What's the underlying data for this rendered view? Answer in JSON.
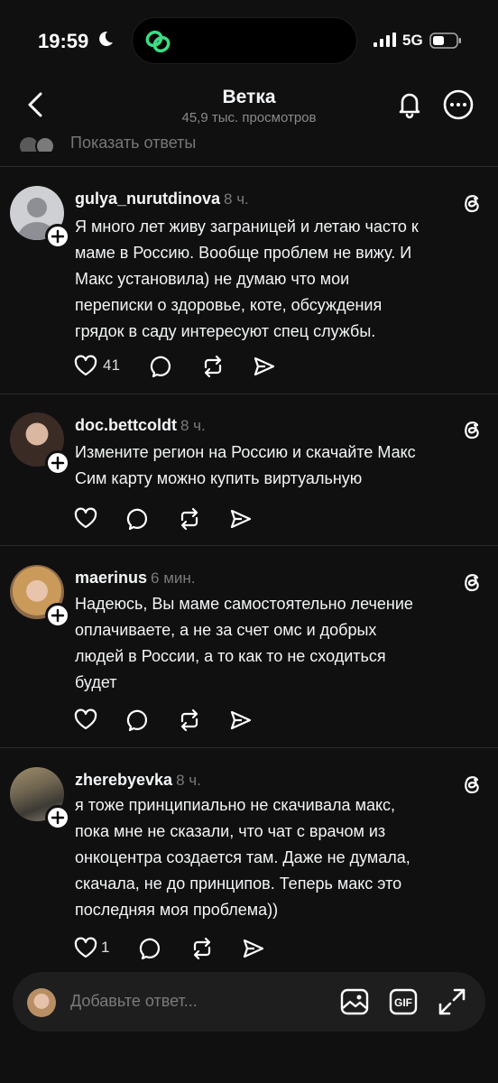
{
  "status_bar": {
    "time": "19:59",
    "network": "5G"
  },
  "header": {
    "title": "Ветка",
    "subtitle": "45,9 тыс. просмотров"
  },
  "show_replies": {
    "label": "Показать ответы"
  },
  "posts": [
    {
      "username": "gulya_nurutdinova",
      "time": "8 ч.",
      "lines": [
        "Я много лет живу заграницей и летаю часто к",
        "маме в Россию. Вообще проблем не вижу. И",
        "Макс установила) не думаю что мои",
        "переписки о здоровье, коте, обсуждения",
        "грядок в саду интересуют спец службы."
      ],
      "likes": "41"
    },
    {
      "username": "doc.bettcoldt",
      "time": "8 ч.",
      "lines": [
        "Измените регион на Россию и скачайте Макс",
        "Сим карту можно купить виртуальную"
      ],
      "likes": ""
    },
    {
      "username": "maerinus",
      "time": "6 мин.",
      "lines": [
        "Надеюсь, Вы маме самостоятельно лечение",
        "оплачиваете, а не за счет омс и добрых",
        "людей в России, а то как то не сходиться",
        "будет"
      ],
      "likes": ""
    },
    {
      "username": "zherebyevka",
      "time": "8 ч.",
      "lines": [
        "я тоже принципиально не скачивала макс,",
        "пока мне не сказали, что чат с врачом из",
        "онкоцентра создается там. Даже не думала,",
        "скачала, не до принципов. Теперь макс это",
        "последняя моя проблема))"
      ],
      "likes": "1"
    }
  ],
  "reply_bar": {
    "placeholder": "Добавьте ответ...",
    "gif_label": "GIF"
  },
  "colors": {
    "background": "#101010",
    "text": "#f3f5f7",
    "secondary": "#7a7a7a",
    "accent_green": "#3ddc84"
  }
}
